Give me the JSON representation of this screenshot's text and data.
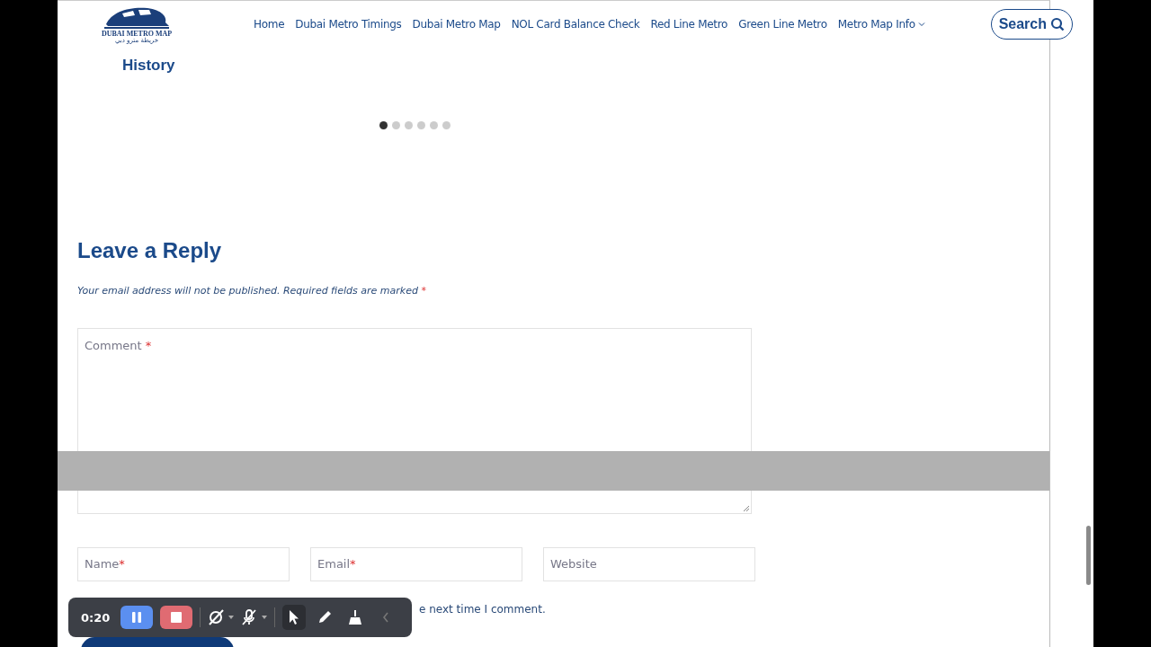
{
  "header": {
    "logo": {
      "name": "DUBAI METRO MAP",
      "tagline": "خريطة مترو دبي"
    },
    "nav": [
      {
        "label": "Home",
        "dropdown": false
      },
      {
        "label": "Dubai Metro Timings",
        "dropdown": false
      },
      {
        "label": "Dubai Metro Map",
        "dropdown": false
      },
      {
        "label": "NOL Card Balance Check",
        "dropdown": false
      },
      {
        "label": "Red Line Metro",
        "dropdown": false
      },
      {
        "label": "Green Line Metro",
        "dropdown": false
      },
      {
        "label": "Metro Map Info",
        "dropdown": true
      }
    ],
    "search": {
      "label": "Search"
    }
  },
  "related": {
    "title_fragment": "History",
    "dots": [
      {
        "selected": true
      },
      {
        "selected": false
      },
      {
        "selected": false
      },
      {
        "selected": false
      },
      {
        "selected": false
      },
      {
        "selected": false
      }
    ]
  },
  "reply": {
    "heading": "Leave a Reply",
    "note": "Your email address will not be published. Required fields are marked",
    "note_mark": "*",
    "comment": {
      "label": "Comment",
      "required_mark": "*"
    },
    "fields": [
      {
        "label": "Name",
        "required_mark": "*"
      },
      {
        "label": "Email",
        "required_mark": "*"
      },
      {
        "label": "Website"
      }
    ],
    "consent_fragment": "e next time I comment."
  },
  "recorder": {
    "time": "0:20",
    "tools": [
      {
        "kind": "pause"
      },
      {
        "kind": "stop"
      },
      {
        "kind": "camera-off",
        "menu": true
      },
      {
        "kind": "mic-off",
        "menu": true
      },
      {
        "kind": "pointer",
        "selected": true
      },
      {
        "kind": "pen",
        "selected": false
      },
      {
        "kind": "broom",
        "selected": false
      },
      {
        "kind": "collapse"
      }
    ]
  }
}
